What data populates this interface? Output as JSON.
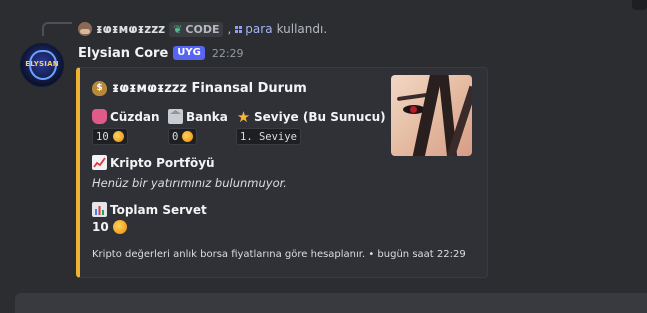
{
  "reply": {
    "user": "ᵻⱷᵻмⱷᵻzzz",
    "command_chip": "CODE",
    "separator": ",",
    "command": "para",
    "suffix": "kullandı."
  },
  "message": {
    "author": "Elysian Core",
    "badge": "UYG",
    "time": "22:29",
    "avatar_text": "ELYSIAN"
  },
  "embed": {
    "accent_color": "#f0b232",
    "title": "ᵻⱷᵻмⱷᵻzzz Finansal Durum",
    "fields": {
      "wallet": {
        "name": "Cüzdan",
        "value": "10"
      },
      "bank": {
        "name": "Banka",
        "value": "0"
      },
      "level": {
        "name": "Seviye (Bu Sunucu)",
        "value": "1. Seviye"
      },
      "crypto": {
        "name": "Kripto Portföyü",
        "value": "Henüz bir yatırımınız bulunmuyor."
      },
      "total": {
        "name": "Toplam Servet",
        "value": "10"
      }
    },
    "footer": "Kripto değerleri anlık borsa fiyatlarına göre hesaplanır. • bugün saat 22:29"
  },
  "icons": {
    "title": "money-bag-icon",
    "wallet": "purse-icon",
    "bank": "bank-icon",
    "level": "star-icon",
    "crypto": "chart-increasing-icon",
    "total": "bar-chart-icon",
    "coin": "coin-icon"
  }
}
